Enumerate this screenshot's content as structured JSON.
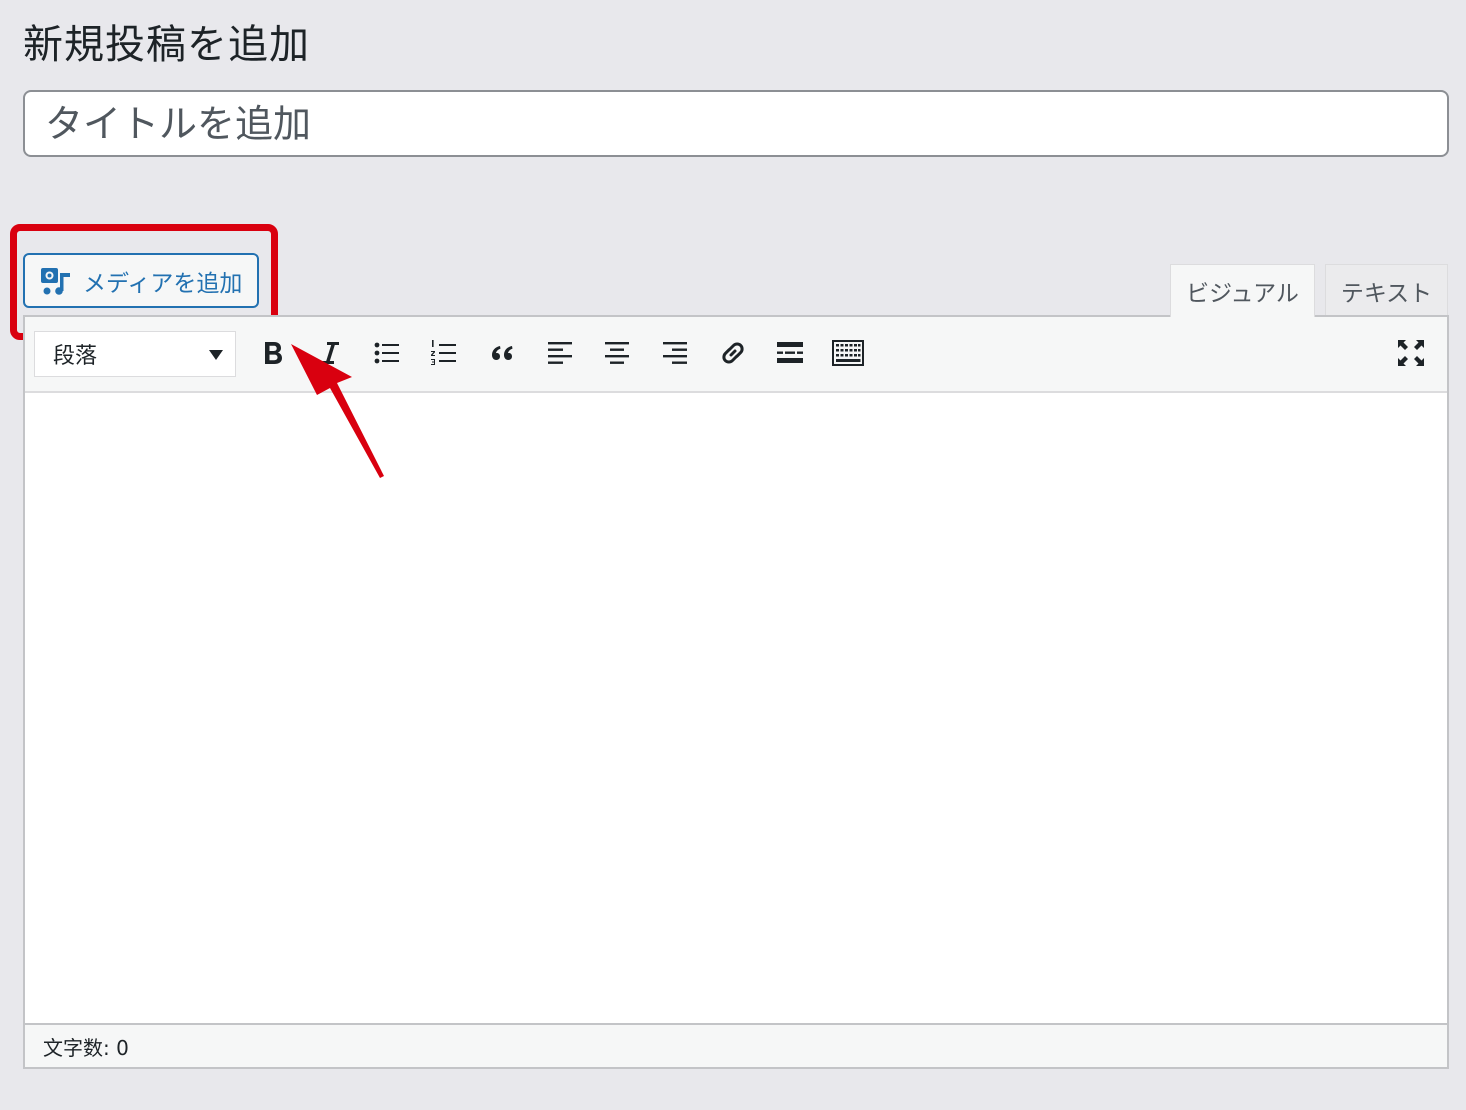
{
  "page": {
    "title": "新規投稿を追加"
  },
  "title_field": {
    "placeholder": "タイトルを追加",
    "value": ""
  },
  "media": {
    "label": "メディアを追加",
    "icon": "media-add-icon"
  },
  "tabs": [
    {
      "label": "ビジュアル",
      "active": true
    },
    {
      "label": "テキスト",
      "active": false
    }
  ],
  "toolbar": {
    "format_select": {
      "value": "段落",
      "icon": "caret-down-icon"
    },
    "buttons": [
      {
        "name": "bold",
        "icon": "bold-icon"
      },
      {
        "name": "italic",
        "icon": "italic-icon"
      },
      {
        "name": "bulleted-list",
        "icon": "bulleted-list-icon"
      },
      {
        "name": "numbered-list",
        "icon": "numbered-list-icon"
      },
      {
        "name": "blockquote",
        "icon": "quote-icon"
      },
      {
        "name": "align-left",
        "icon": "align-left-icon"
      },
      {
        "name": "align-center",
        "icon": "align-center-icon"
      },
      {
        "name": "align-right",
        "icon": "align-right-icon"
      },
      {
        "name": "insert-link",
        "icon": "link-icon"
      },
      {
        "name": "read-more",
        "icon": "read-more-icon"
      },
      {
        "name": "toolbar-toggle",
        "icon": "keyboard-icon"
      },
      {
        "name": "fullscreen",
        "icon": "fullscreen-icon"
      }
    ]
  },
  "status": {
    "word_count": "文字数: 0"
  },
  "annotation": {
    "color": "#d9000f"
  },
  "colors": {
    "accent": "#2271b1",
    "background": "#e8e8ec"
  }
}
